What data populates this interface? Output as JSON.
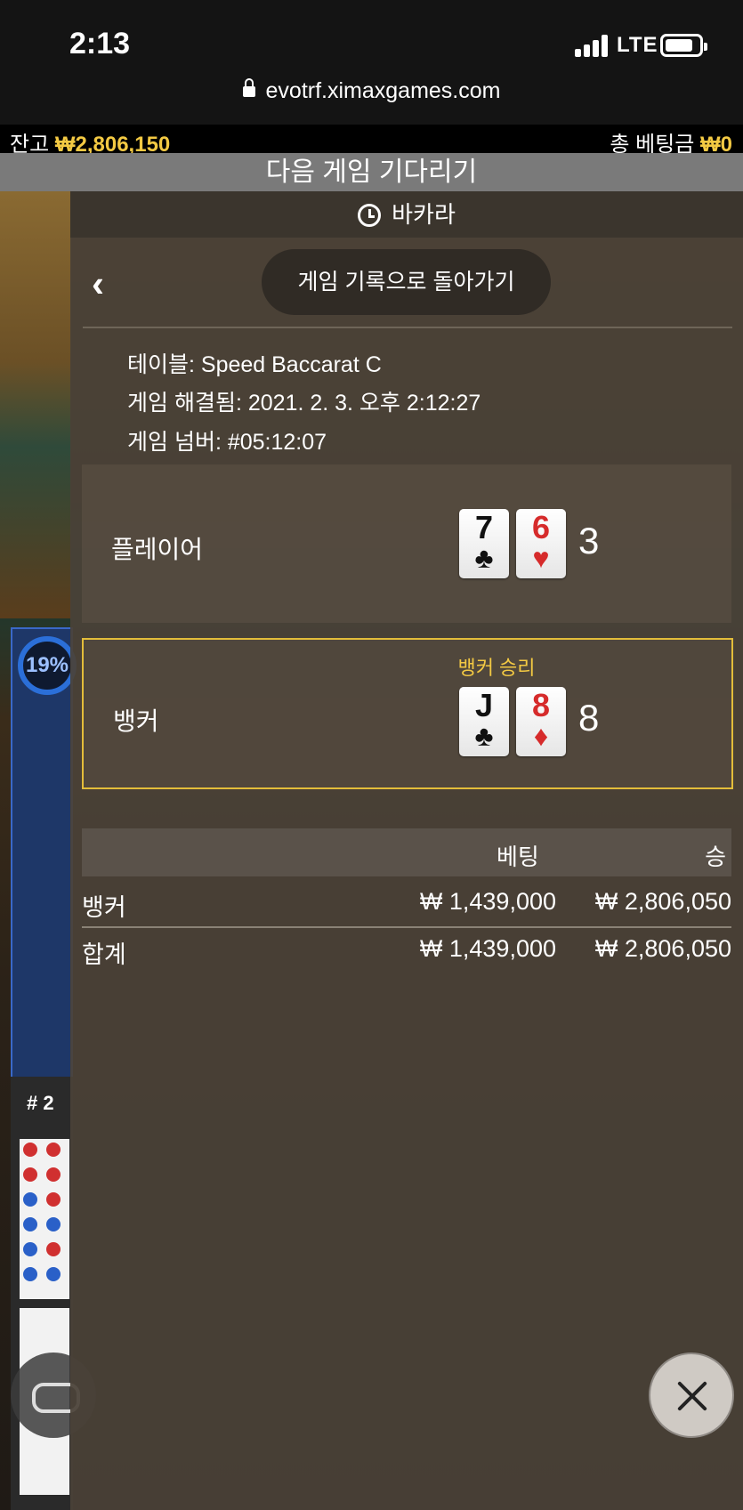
{
  "status_bar": {
    "time": "2:13",
    "network": "LTE",
    "url": "evotrf.ximaxgames.com"
  },
  "balance_bar": {
    "balance_label": "잔고",
    "balance_value": "₩2,806,150",
    "total_bet_label": "총 베팅금",
    "total_bet_value": "₩0"
  },
  "wait_banner": "다음 게임 기다리기",
  "background": {
    "progress_percent": "19%",
    "road_label": "# 2"
  },
  "panel": {
    "header_title": "바카라",
    "back_button": "게임 기록으로 돌아가기",
    "info": {
      "table": "테이블: Speed Baccarat C",
      "resolved": "게임 해결됨: 2021. 2. 3. 오후 2:12:27",
      "number": "게임 넘버: #05:12:07"
    },
    "player": {
      "label": "플레이어",
      "cards": [
        {
          "rank": "7",
          "suit": "♣",
          "color": "black"
        },
        {
          "rank": "6",
          "suit": "♥",
          "color": "red"
        }
      ],
      "score": "3"
    },
    "banker": {
      "label": "뱅커",
      "win_label": "뱅커 승리",
      "cards": [
        {
          "rank": "J",
          "suit": "♣",
          "color": "black"
        },
        {
          "rank": "8",
          "suit": "♦",
          "color": "red"
        }
      ],
      "score": "8"
    },
    "bets": {
      "header_bet": "베팅",
      "header_win": "승",
      "rows": [
        {
          "name": "뱅커",
          "bet": "₩ 1,439,000",
          "win": "₩ 2,806,050"
        },
        {
          "name": "합계",
          "bet": "₩ 1,439,000",
          "win": "₩ 2,806,050"
        }
      ]
    }
  },
  "colors": {
    "accent_gold": "#f3c943",
    "panel_bg": "#4a4238",
    "card_red": "#d62b2b"
  }
}
